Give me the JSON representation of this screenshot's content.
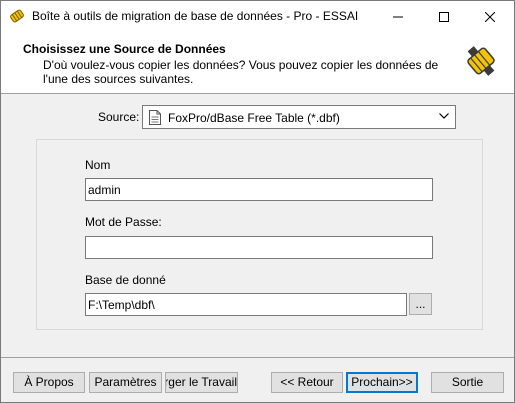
{
  "window": {
    "title": "Boîte à outils de migration de base de données - Pro - ESSAI"
  },
  "header": {
    "title": "Choisissez une Source de Données",
    "description": "D'où voulez-vous copier les données? Vous pouvez copier les données de l'une des sources suivantes."
  },
  "source": {
    "label": "Source:",
    "selected": "FoxPro/dBase Free Table (*.dbf)"
  },
  "form": {
    "name_label": "Nom",
    "name_value": "admin",
    "password_label": "Mot de Passe:",
    "password_value": "",
    "database_label": "Base de donné",
    "database_value": "F:\\Temp\\dbf\\",
    "browse_label": "..."
  },
  "buttons": {
    "about": "À Propos",
    "settings": "Paramètres",
    "load_job": "Charger le Travail",
    "back": "<< Retour",
    "next": "Prochain>>",
    "exit": "Sortie"
  },
  "colors": {
    "accent": "#0078d7",
    "icon_yellow": "#f5c400"
  }
}
